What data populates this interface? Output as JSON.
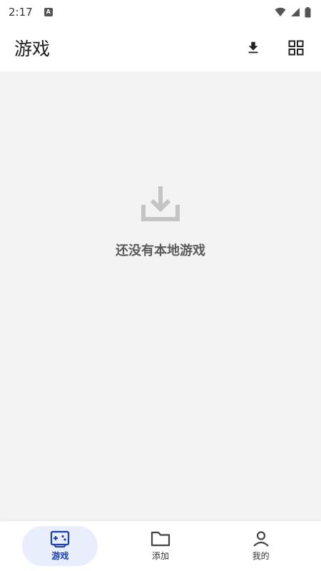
{
  "status_bar": {
    "time": "2:17",
    "app_icon_letter": "A",
    "icons": [
      "wifi-icon",
      "signal-icon",
      "battery-icon"
    ]
  },
  "app_bar": {
    "title": "游戏",
    "actions": [
      "download-icon",
      "grid-view-icon"
    ]
  },
  "empty_state": {
    "icon": "download-tray-icon",
    "message": "还没有本地游戏"
  },
  "bottom_nav": {
    "items": [
      {
        "label": "游戏",
        "icon": "gamepad-icon",
        "active": true
      },
      {
        "label": "添加",
        "icon": "folder-icon",
        "active": false
      },
      {
        "label": "我的",
        "icon": "person-icon",
        "active": false
      }
    ]
  },
  "colors": {
    "accent": "#1e40a8",
    "active_pill": "#e9eefc",
    "content_bg": "#f3f3f3",
    "empty_icon": "#c4c4c4",
    "empty_text": "#5b5b5b"
  }
}
